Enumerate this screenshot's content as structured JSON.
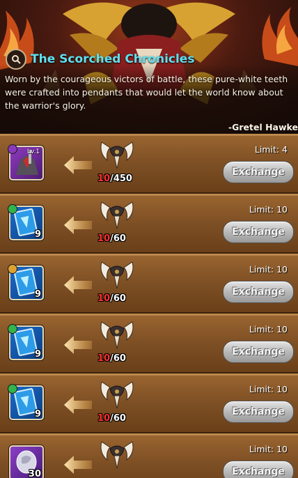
{
  "header": {
    "title": "The Scorched Chronicles",
    "title_icon": "search-icon",
    "quote": "Worn by the courageous victors of battle, these pure-white teeth were crafted into pendants that would let the world know about the warrior's glory.",
    "author": "-Gretel Hawke"
  },
  "currency_icon": "horned-tooth-pendant-icon",
  "rows": [
    {
      "item": "hero-unit",
      "level": "Lv.1",
      "quantity": "",
      "badge_color": "#8a3ab8",
      "have": "10",
      "need": "/450",
      "limit": "Limit: 4",
      "button": "Exchange"
    },
    {
      "item": "card",
      "level": "",
      "quantity": "9",
      "badge_color": "#34b34a",
      "have": "10",
      "need": "/60",
      "limit": "Limit: 10",
      "button": "Exchange"
    },
    {
      "item": "card",
      "level": "",
      "quantity": "9",
      "badge_color": "#e0a030",
      "have": "10",
      "need": "/60",
      "limit": "Limit: 10",
      "button": "Exchange"
    },
    {
      "item": "card",
      "level": "",
      "quantity": "9",
      "badge_color": "#34b34a",
      "have": "10",
      "need": "/60",
      "limit": "Limit: 10",
      "button": "Exchange"
    },
    {
      "item": "card",
      "level": "",
      "quantity": "9",
      "badge_color": "#34b34a",
      "have": "10",
      "need": "/60",
      "limit": "Limit: 10",
      "button": "Exchange"
    },
    {
      "item": "stone",
      "level": "",
      "quantity": "30",
      "badge_color": "",
      "have": "",
      "need": "",
      "limit": "Limit: 10",
      "button": "Exchange"
    }
  ]
}
